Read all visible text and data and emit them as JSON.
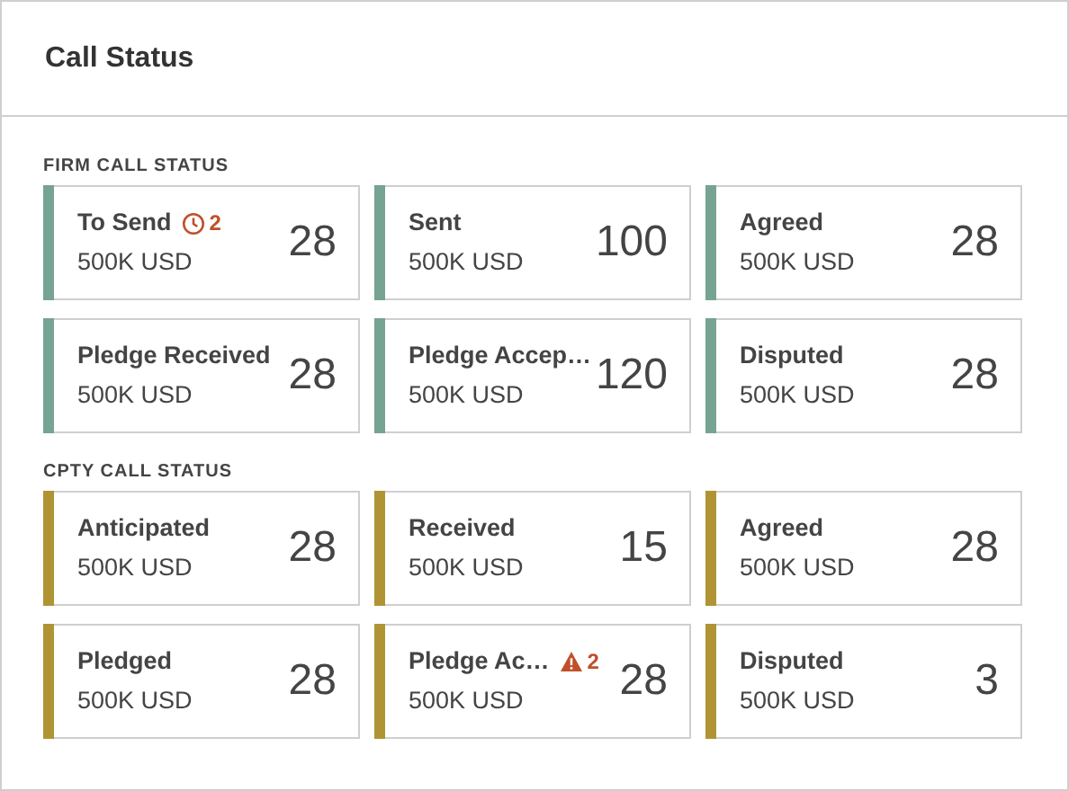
{
  "panel": {
    "title": "Call Status"
  },
  "sections": [
    {
      "heading": "FIRM CALL STATUS",
      "color": "#76a392",
      "cards": [
        {
          "title": "To Send",
          "amount": "500K USD",
          "count": "28",
          "alert": {
            "kind": "clock",
            "count": "2"
          }
        },
        {
          "title": "Sent",
          "amount": "500K USD",
          "count": "100"
        },
        {
          "title": "Agreed",
          "amount": "500K USD",
          "count": "28"
        },
        {
          "title": "Pledge Received",
          "amount": "500K USD",
          "count": "28"
        },
        {
          "title": "Pledge Accep…",
          "amount": "500K USD",
          "count": "120"
        },
        {
          "title": "Disputed",
          "amount": "500K USD",
          "count": "28"
        }
      ]
    },
    {
      "heading": "CPTY CALL STATUS",
      "color": "#b09433",
      "cards": [
        {
          "title": "Anticipated",
          "amount": "500K USD",
          "count": "28"
        },
        {
          "title": "Received",
          "amount": "500K USD",
          "count": "15"
        },
        {
          "title": "Agreed",
          "amount": "500K USD",
          "count": "28"
        },
        {
          "title": "Pledged",
          "amount": "500K USD",
          "count": "28"
        },
        {
          "title": "Pledge Ac…",
          "amount": "500K USD",
          "count": "28",
          "alert": {
            "kind": "warning",
            "count": "2"
          }
        },
        {
          "title": "Disputed",
          "amount": "500K USD",
          "count": "3"
        }
      ]
    }
  ]
}
